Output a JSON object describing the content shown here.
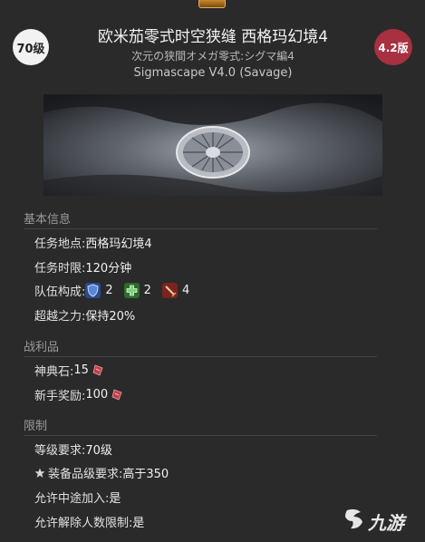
{
  "header": {
    "level": "70级",
    "version": "4.2版",
    "title": "欧米茄零式时空狭缝 西格玛幻境4",
    "subtitle_jp": "次元の狭間オメガ零式:シグマ編4",
    "subtitle_en": "Sigmascape V4.0 (Savage)"
  },
  "sections": {
    "basic": {
      "heading": "基本信息",
      "location_label": "任务地点:",
      "location_value": "西格玛幻境4",
      "time_label": "任务时限:",
      "time_value": "120分钟",
      "party_label": "队伍构成:",
      "tank_count": "2",
      "healer_count": "2",
      "dps_count": "4",
      "sync_label": "超越之力:",
      "sync_value": "保持20%"
    },
    "loot": {
      "heading": "战利品",
      "tomestone_label": "神典石:",
      "tomestone_value": "15",
      "rookie_label": "新手奖励:",
      "rookie_value": "100"
    },
    "restrictions": {
      "heading": "限制",
      "level_label": "等级要求:",
      "level_value": "70级",
      "ilvl_label": "装备品级要求:",
      "ilvl_value": "高于350",
      "join_label": "允许中途加入:",
      "join_value": "是",
      "unrestricted_label": "允许解除人数限制:",
      "unrestricted_value": "是"
    }
  },
  "watermark": {
    "text": "九游"
  },
  "colors": {
    "background": "#2a2a2a",
    "version_badge": "#a83040",
    "level_badge": "#f2f2f2",
    "tank": "#3a62b8",
    "healer": "#3c8a3a",
    "dps": "#a0302c"
  },
  "icons": {
    "tank": "shield-icon",
    "healer": "healer-cross-icon",
    "dps": "sword-icon",
    "ticket": "tomestone-icon",
    "ilvl": "gear-star-icon"
  }
}
